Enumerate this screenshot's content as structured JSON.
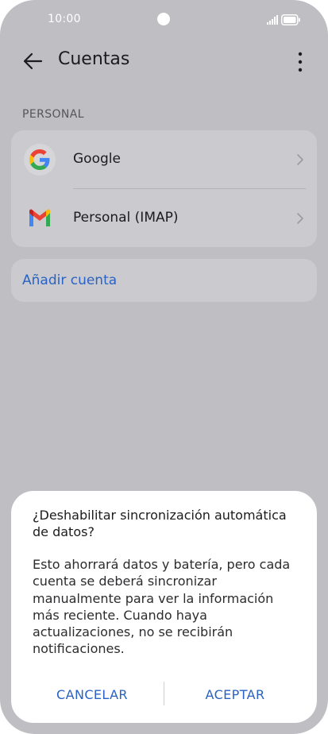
{
  "status_bar": {
    "time": "10:00"
  },
  "app_bar": {
    "title": "Cuentas"
  },
  "section": {
    "label": "PERSONAL"
  },
  "accounts": [
    {
      "label": "Google",
      "icon": "google-logo-icon"
    },
    {
      "label": "Personal (IMAP)",
      "icon": "gmail-logo-icon"
    }
  ],
  "add_account": {
    "label": "Añadir cuenta"
  },
  "dialog": {
    "title": "¿Deshabilitar sincronización automática de datos?",
    "body": "Esto ahorrará datos y batería, pero cada cuenta se deberá sincronizar manualmente para ver la información más reciente. Cuando haya actualizaciones, no se recibirán notificaciones.",
    "cancel_label": "CANCELAR",
    "accept_label": "ACEPTAR"
  },
  "colors": {
    "accent": "#2a62c4",
    "background": "#bfbfc3",
    "card": "#cbcbcf"
  }
}
